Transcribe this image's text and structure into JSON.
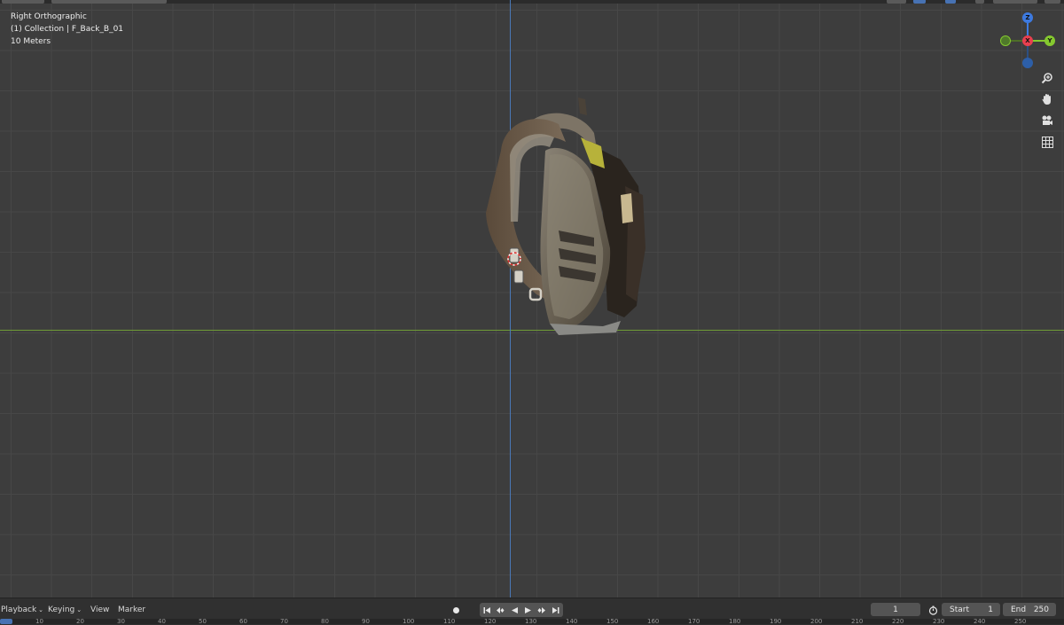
{
  "viewport": {
    "view_name": "Right Orthographic",
    "collection_info": "(1) Collection | F_Back_B_01",
    "scale": "10 Meters"
  },
  "gizmo": {
    "z_label": "Z",
    "x_label": "X",
    "y_label": "Y",
    "colors": {
      "x": "#e8404f",
      "y": "#85c92f",
      "z": "#3d7ae0"
    }
  },
  "nav_tools": [
    {
      "name": "zoom-icon",
      "glyph": "🔍"
    },
    {
      "name": "hand-icon",
      "glyph": "✋"
    },
    {
      "name": "camera-icon",
      "glyph": "🎥"
    },
    {
      "name": "grid-icon",
      "glyph": "▦"
    }
  ],
  "timeline": {
    "playback_label": "Playback",
    "keying_label": "Keying",
    "view_label": "View",
    "marker_label": "Marker",
    "current_frame": "1",
    "start_label": "Start",
    "start_value": "1",
    "end_label": "End",
    "end_value": "250"
  },
  "ruler_ticks": [
    "10",
    "20",
    "30",
    "40",
    "50",
    "60",
    "70",
    "80",
    "90",
    "100",
    "110",
    "120",
    "130",
    "140",
    "150",
    "160",
    "170",
    "180",
    "190",
    "200",
    "210",
    "220",
    "230",
    "240",
    "250"
  ]
}
